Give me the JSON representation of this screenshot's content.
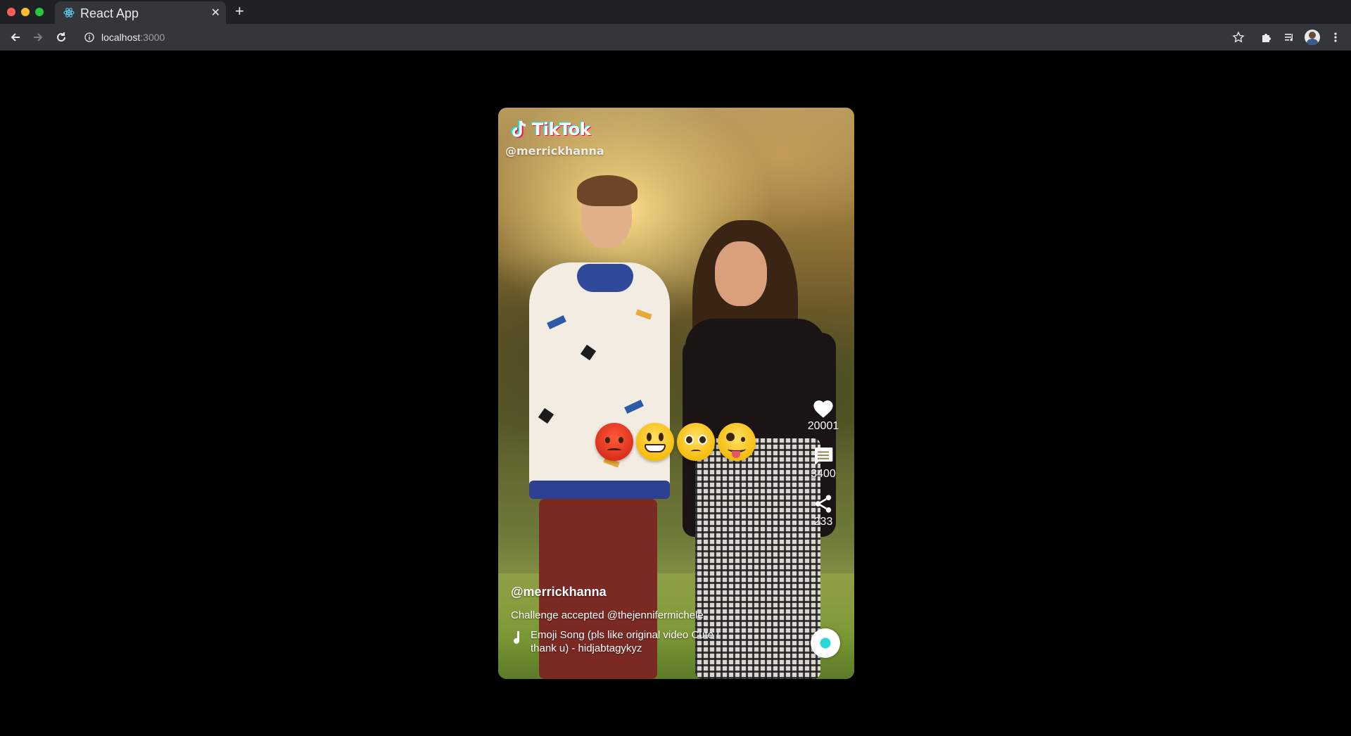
{
  "browser": {
    "tab_title": "React App",
    "url_host": "localhost",
    "url_port": ":3000"
  },
  "video": {
    "logo_text": "TikTok",
    "watermark_handle": "@merrickhanna",
    "emojis": [
      "angry-face",
      "grinning-face",
      "pleading-face",
      "zany-face"
    ],
    "likes": "20001",
    "comments": "3400",
    "shares": "233",
    "channel": "@merrickhanna",
    "description": "Challenge accepted @thejennifermichele",
    "song": "Emoji Song (pls like original video Cute I thank u) - hidjabtagykyz"
  },
  "colors": {
    "page_background": "#000000",
    "chrome_dark": "#202124",
    "toolbar": "#35363a",
    "tiktok_pink": "#ff0050",
    "tiktok_cyan": "#00f2ea"
  }
}
